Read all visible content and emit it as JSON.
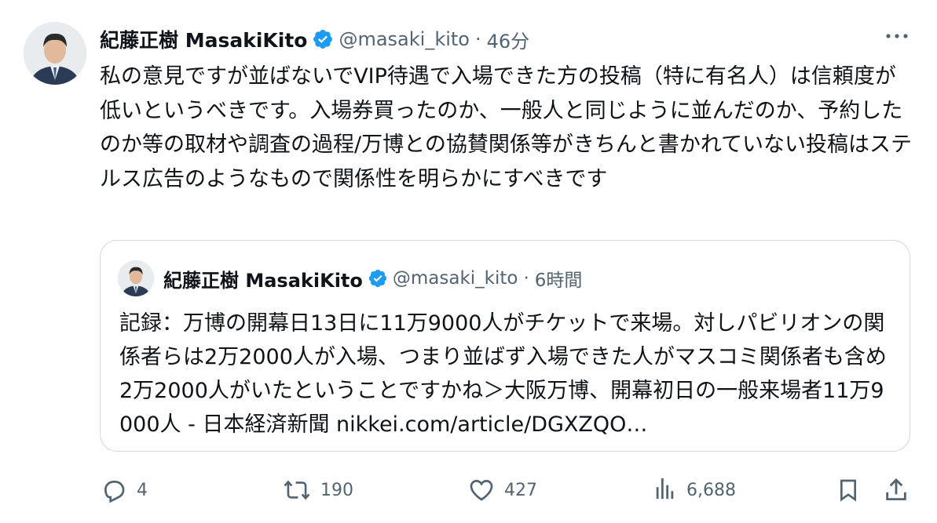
{
  "tweet": {
    "author_name": "紀藤正樹 MasakiKito",
    "handle": "@masaki_kito",
    "separator": "·",
    "time": "46分",
    "text": "私の意見ですが並ばないでVIP待遇で入場できた方の投稿（特に有名人）は信頼度が低いというべきです。入場券買ったのか、一般人と同じように並んだのか、予約したのか等の取材や調査の過程/万博との協賛関係等がきちんと書かれていない投稿はステルス広告のようなもので関係性を明らかにすべきです"
  },
  "quote": {
    "author_name": "紀藤正樹 MasakiKito",
    "handle": "@masaki_kito",
    "separator": "·",
    "time": "6時間",
    "text": "記録：万博の開幕日13日に11万9000人がチケットで来場。対しパビリオンの関係者らは2万2000人が入場、つまり並ばず入場できた人がマスコミ関係者も含め2万2000人がいたということですかね＞大阪万博、開幕初日の一般来場者11万9000人 - 日本経済新聞 nikkei.com/article/DGXZQO…"
  },
  "actions": {
    "replies": "4",
    "retweets": "190",
    "likes": "427",
    "views": "6,688"
  },
  "icons": {
    "verified": "verified-badge-icon",
    "more": "more-dots-icon",
    "reply": "reply-icon",
    "retweet": "retweet-icon",
    "like": "heart-icon",
    "views": "views-chart-icon",
    "bookmark": "bookmark-icon",
    "share": "share-icon"
  },
  "colors": {
    "verified": "#1d9bf0",
    "text": "#0f1419",
    "secondary": "#536471",
    "border": "#cfd9de"
  }
}
